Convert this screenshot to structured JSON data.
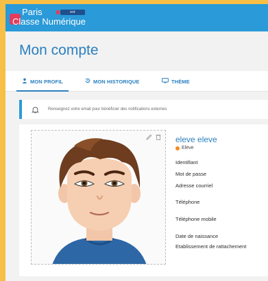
{
  "header": {
    "brand_line1": "Paris",
    "brand_line2": "Classe Numérique",
    "badge": "ent"
  },
  "page": {
    "title": "Mon compte"
  },
  "tabs": [
    {
      "label": "MON PROFIL",
      "icon": "person-icon",
      "active": true
    },
    {
      "label": "MON HISTORIQUE",
      "icon": "history-icon",
      "active": false
    },
    {
      "label": "THÈME",
      "icon": "monitor-icon",
      "active": false
    }
  ],
  "notice": {
    "icon": "bell-icon",
    "text": "Renseignez votre email pour bénéficier des notifications externes"
  },
  "profile": {
    "name": "eleve eleve",
    "role": "Elève",
    "role_color": "#f28b1e",
    "fields": [
      "Identifiant",
      "Mot de passe",
      "Adresse courriel",
      "Téléphone",
      "Téléphone mobile",
      "Date de naissance",
      "Etablissement de rattachement"
    ]
  },
  "colors": {
    "accent": "#2a7fc0",
    "header": "#2a9ad8",
    "page_border": "#f7bf45"
  }
}
